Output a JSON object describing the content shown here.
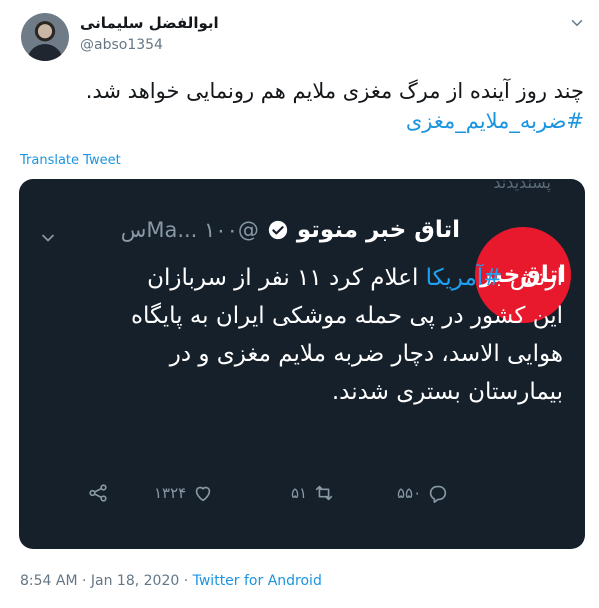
{
  "author": {
    "name": "ابوالفضل سلیمانی",
    "handle": "@abso1354"
  },
  "tweet": {
    "text_line1": "چند روز آینده از مرگ مغزی ملایم هم رونمایی خواهد شد.",
    "hashtag": "#ضربه_ملایم_مغزی"
  },
  "translate_label": "Translate Tweet",
  "media": {
    "liked_label": "پسندیدند",
    "logo_text": "اتاق‌خبر",
    "inner_name": "اتاق خبر منوتو",
    "inner_handle": "@Ma... ۱۰۰س",
    "inner_text_before": "ارتش ",
    "inner_hashtag": "#آمریکا",
    "inner_text_after": " اعلام کرد ۱۱ نفر از سربازان این کشور در پی حمله موشکی ایران به پایگاه هوایی الاسد، دچار ضربه ملایم مغزی و در بیمارستان بستری شدند.",
    "reply_count": "۵۵۰",
    "retweet_count": "۵۱",
    "like_count": "۱۳۲۴"
  },
  "footer": {
    "time": "8:54 AM · Jan 18, 2020 · ",
    "source": "Twitter for Android"
  },
  "icons": {
    "verified": "verified-badge-icon",
    "share": "share-icon",
    "like": "heart-icon",
    "retweet": "retweet-icon",
    "reply": "reply-icon",
    "caret": "chevron-down-icon"
  }
}
